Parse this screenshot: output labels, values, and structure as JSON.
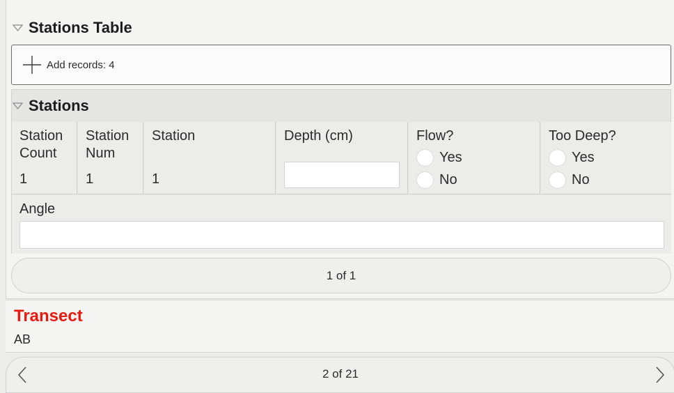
{
  "stations_table": {
    "title": "Stations Table",
    "add_records_label": "Add records: 4"
  },
  "stations": {
    "title": "Stations",
    "columns": {
      "station_count": {
        "label": "Station Count",
        "value": "1"
      },
      "station_num": {
        "label": "Station Num",
        "value": "1"
      },
      "station": {
        "label": "Station",
        "value": "1"
      },
      "depth": {
        "label": "Depth (cm)",
        "value": ""
      },
      "flow": {
        "label": "Flow?",
        "options": [
          "Yes",
          "No"
        ]
      },
      "too_deep": {
        "label": "Too Deep?",
        "options": [
          "Yes",
          "No"
        ]
      }
    },
    "angle": {
      "label": "Angle",
      "value": ""
    },
    "pager_label": "1 of 1"
  },
  "transect": {
    "title": "Transect",
    "value": "AB"
  },
  "bottom_pager": {
    "label": "2 of 21"
  },
  "colors": {
    "accent_red": "#e8190f",
    "panel_gray": "#e5e5e4",
    "background": "#ececeb"
  }
}
